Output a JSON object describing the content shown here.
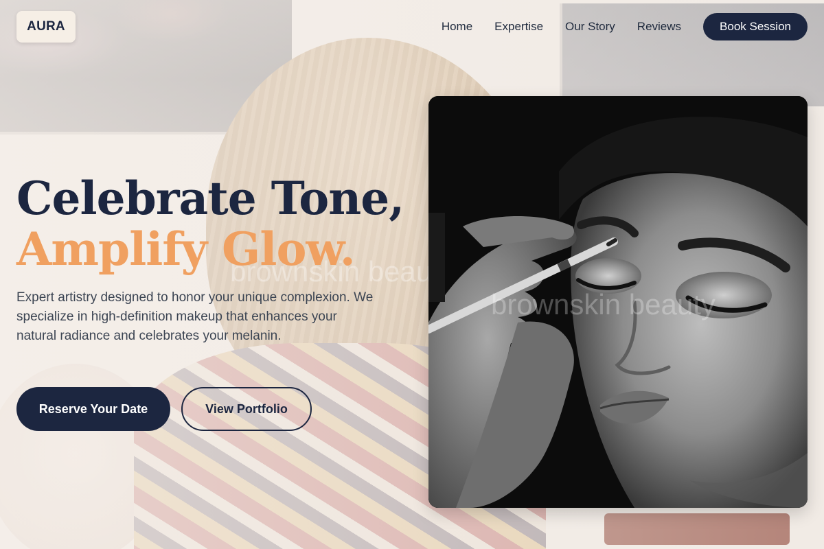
{
  "brand": {
    "logo_text": "AURA"
  },
  "nav": {
    "links": [
      "Home",
      "Expertise",
      "Our Story",
      "Reviews"
    ],
    "cta_label": "Book Session"
  },
  "hero": {
    "headline_line1": "Celebrate Tone,",
    "headline_line2": "Amplify Glow.",
    "description": "Expert artistry designed to honor your unique complexion. We specialize in high-definition makeup that enhances your natural radiance and celebrates your melanin.",
    "primary_button": "Reserve Your Date",
    "secondary_button": "View Portfolio"
  },
  "photo": {
    "watermark": "brownskin beauty"
  },
  "colors": {
    "navy": "#1c2640",
    "accent_orange": "#f0a060",
    "body_text": "#3b4452"
  }
}
